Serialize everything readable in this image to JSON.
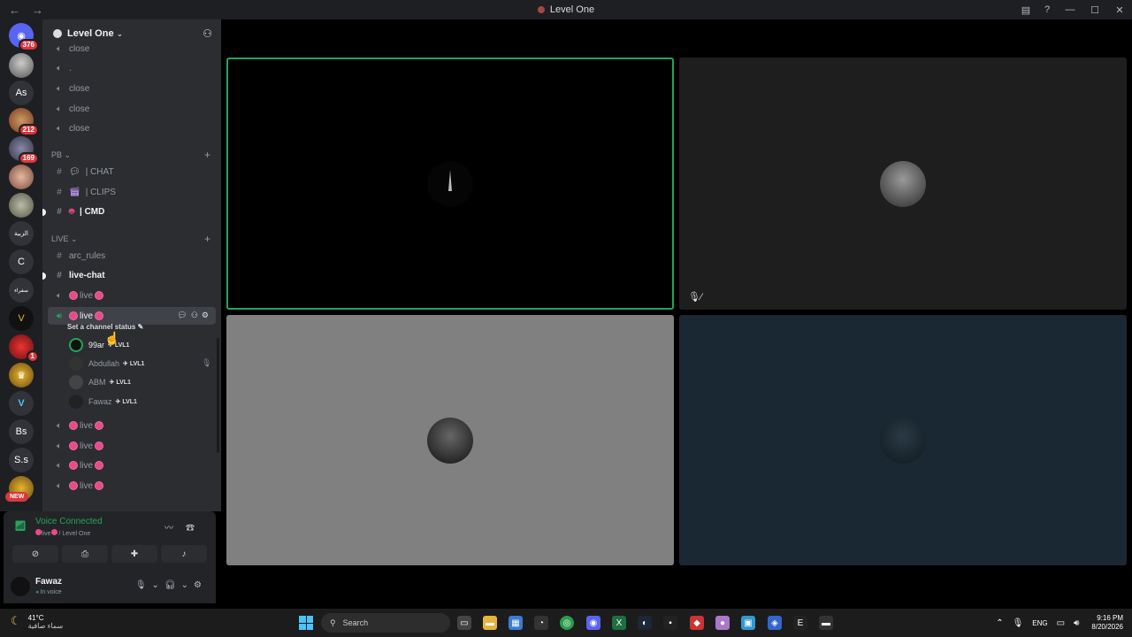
{
  "window": {
    "title": "Level One",
    "icons": [
      "back-icon",
      "inbox-icon",
      "help-icon",
      "minimize-icon",
      "maximize-icon",
      "close-icon"
    ]
  },
  "guilds": [
    {
      "label": "",
      "badge": "376",
      "kind": "home"
    },
    {
      "label": "",
      "badge": "",
      "kind": "img1"
    },
    {
      "label": "As",
      "badge": ""
    },
    {
      "label": "",
      "badge": "212",
      "kind": "img2"
    },
    {
      "label": "",
      "badge": "169",
      "kind": "img3"
    },
    {
      "label": "",
      "badge": "",
      "kind": "img4"
    },
    {
      "label": "",
      "badge": "",
      "kind": "img5"
    },
    {
      "label": "الزبية",
      "badge": ""
    },
    {
      "label": "C",
      "badge": ""
    },
    {
      "label": "سفراء",
      "badge": ""
    },
    {
      "label": "V",
      "badge": "",
      "kind": "dark"
    },
    {
      "label": "",
      "badge": "1",
      "kind": "red"
    },
    {
      "label": "♛",
      "badge": "",
      "kind": "gold"
    },
    {
      "label": "V",
      "badge": ""
    },
    {
      "label": "Bs",
      "badge": ""
    },
    {
      "label": "S.s",
      "badge": ""
    },
    {
      "label": "",
      "badge": "",
      "kind": "gold"
    }
  ],
  "new_badge": "NEW",
  "server": {
    "name": "Level One"
  },
  "channels": {
    "close_1": "close",
    "dot": ".",
    "close_2": "close",
    "close_3": "close",
    "close_4": "close",
    "cat_pb": "PB",
    "chat": "| CHAT",
    "clips": "| CLIPS",
    "cmd": "| CMD",
    "cat_live": "LIVE",
    "arc_rules": "arc_rules",
    "live_chat": "live-chat",
    "live_1": "live",
    "live_selected": "live",
    "status_hint": "Set a channel status",
    "live_3": "live",
    "live_4": "live",
    "live_5": "live",
    "live_6": "live"
  },
  "voice_users": [
    {
      "name": "99ar",
      "tag": "LVL1"
    },
    {
      "name": "Abdullah",
      "tag": "LVL1"
    },
    {
      "name": "ABM",
      "tag": "LVL1"
    },
    {
      "name": "Fawaz",
      "tag": "LVL1"
    }
  ],
  "voice_panel": {
    "status": "Voice Connected",
    "channel_live": "live",
    "server": "/ Level One"
  },
  "user_panel": {
    "name": "Fawaz",
    "status": "In voice"
  },
  "colors": {
    "speaking_ring": "#23a55a",
    "tile_top_right": "#1e1e1e",
    "tile_bottom_left": "#808080",
    "tile_bottom_right": "#1a2833",
    "live_dot": "#e84a8a"
  },
  "taskbar": {
    "weather_temp": "41°C",
    "weather_desc": "سماء صافية",
    "search_placeholder": "Search",
    "lang": "ENG",
    "time": "9:16 PM",
    "date": "8/20/2026"
  }
}
